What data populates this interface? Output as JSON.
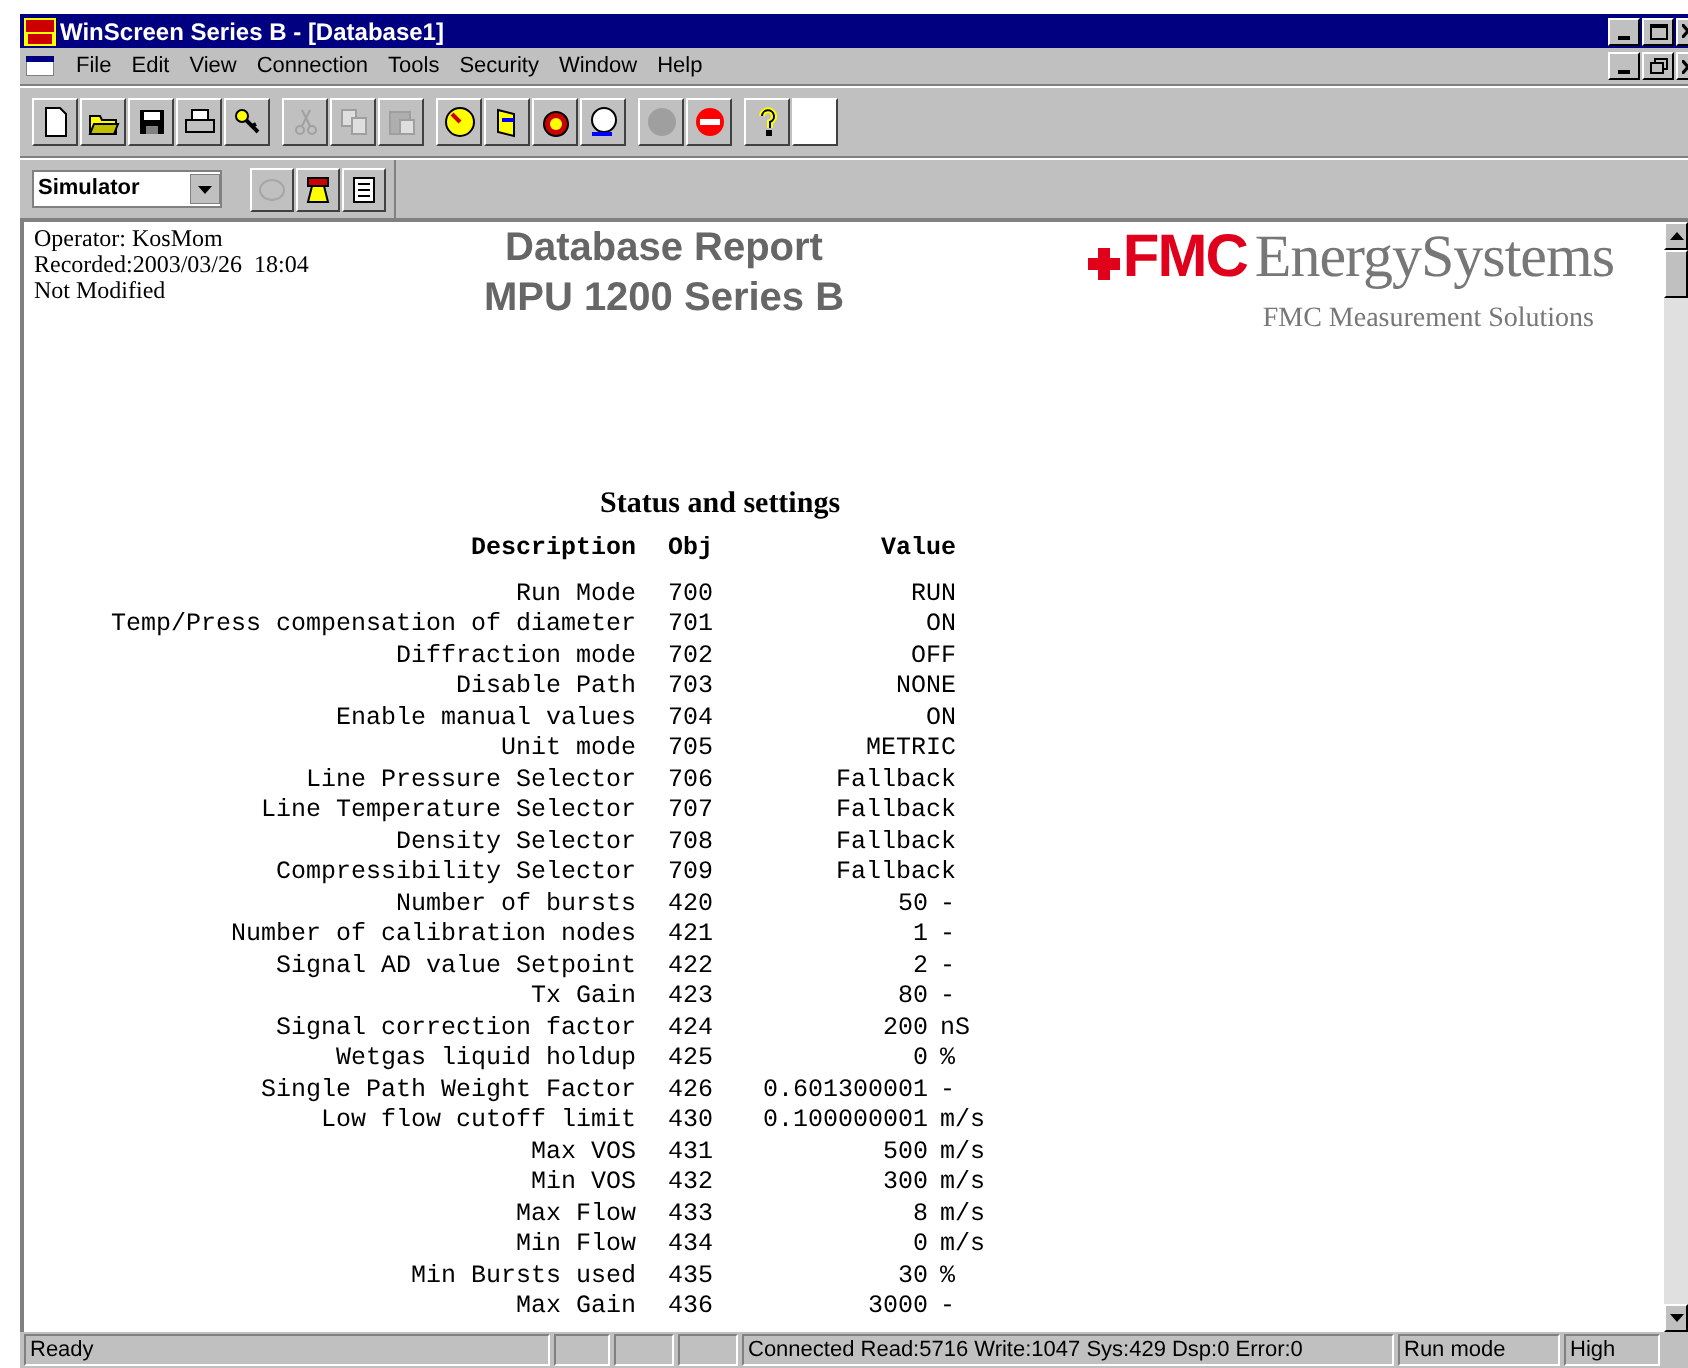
{
  "window": {
    "title": "WinScreen Series B - [Database1]"
  },
  "menu": [
    "File",
    "Edit",
    "View",
    "Connection",
    "Tools",
    "Security",
    "Window",
    "Help"
  ],
  "toolbar": [
    [
      {
        "disabled": false
      },
      {
        "disabled": false
      },
      {
        "disabled": false
      },
      {
        "disabled": false
      },
      {
        "disabled": false
      }
    ],
    [
      {
        "disabled": true
      },
      {
        "disabled": true
      },
      {
        "disabled": true
      }
    ],
    [
      {
        "disabled": false
      },
      {
        "disabled": false
      },
      {
        "disabled": false
      },
      {
        "disabled": false
      }
    ],
    [
      {
        "disabled": true
      },
      {
        "disabled": false
      }
    ],
    [
      {
        "disabled": false
      },
      {
        "disabled": false
      }
    ]
  ],
  "connection_toolbar": {
    "dropdown": "Simulator",
    "buttons": [
      {
        "disabled": true
      },
      {
        "disabled": false
      },
      {
        "disabled": false
      }
    ]
  },
  "report": {
    "info": [
      "Operator: KosMom",
      "Recorded:2003/03/26  18:04",
      "Not Modified"
    ],
    "title": [
      "Database Report",
      "MPU 1200 Series B"
    ],
    "logo": {
      "mark": "FMC",
      "name": "EnergySystems",
      "tagline": "FMC Measurement Solutions"
    },
    "section": "Status and settings",
    "columns": [
      "Description",
      "Obj",
      "Value"
    ],
    "rows": [
      {
        "description": "Run Mode",
        "obj": "700",
        "value": "RUN"
      },
      {
        "description": "Temp/Press compensation of diameter",
        "obj": "701",
        "value": "ON"
      },
      {
        "description": "Diffraction mode",
        "obj": "702",
        "value": "OFF"
      },
      {
        "description": "Disable Path",
        "obj": "703",
        "value": "NONE"
      },
      {
        "description": "Enable manual values",
        "obj": "704",
        "value": "ON"
      },
      {
        "description": "Unit mode",
        "obj": "705",
        "value": "METRIC"
      },
      {
        "description": "Line Pressure Selector",
        "obj": "706",
        "value": "Fallback"
      },
      {
        "description": "Line Temperature Selector",
        "obj": "707",
        "value": "Fallback"
      },
      {
        "description": "Density Selector",
        "obj": "708",
        "value": "Fallback"
      },
      {
        "description": "Compressibility Selector",
        "obj": "709",
        "value": "Fallback"
      },
      {
        "description": "Number of bursts",
        "obj": "420",
        "value": "50",
        "unit": "-"
      },
      {
        "description": "Number of calibration nodes",
        "obj": "421",
        "value": "1",
        "unit": "-"
      },
      {
        "description": "Signal AD value Setpoint",
        "obj": "422",
        "value": "2",
        "unit": "-"
      },
      {
        "description": "Tx Gain",
        "obj": "423",
        "value": "80",
        "unit": "-"
      },
      {
        "description": "Signal correction factor",
        "obj": "424",
        "value": "200",
        "unit": "nS"
      },
      {
        "description": "Wetgas liquid holdup",
        "obj": "425",
        "value": "0",
        "unit": "%"
      },
      {
        "description": "Single Path Weight Factor",
        "obj": "426",
        "value": "0.601300001",
        "unit": "-"
      },
      {
        "description": "Low flow cutoff limit",
        "obj": "430",
        "value": "0.100000001",
        "unit": "m/s"
      },
      {
        "description": "Max VOS",
        "obj": "431",
        "value": "500",
        "unit": "m/s"
      },
      {
        "description": "Min VOS",
        "obj": "432",
        "value": "300",
        "unit": "m/s"
      },
      {
        "description": "Max Flow",
        "obj": "433",
        "value": "8",
        "unit": "m/s"
      },
      {
        "description": "Min Flow",
        "obj": "434",
        "value": "0",
        "unit": "m/s"
      },
      {
        "description": "Min Bursts used",
        "obj": "435",
        "value": "30",
        "unit": "%"
      },
      {
        "description": "Max Gain",
        "obj": "436",
        "value": "3000",
        "unit": "-"
      }
    ]
  },
  "status_bar": {
    "message": "Ready",
    "connection": "Connected Read:5716 Write:1047 Sys:429 Dsp:0 Error:0",
    "mode": "Run mode",
    "access": "High"
  }
}
